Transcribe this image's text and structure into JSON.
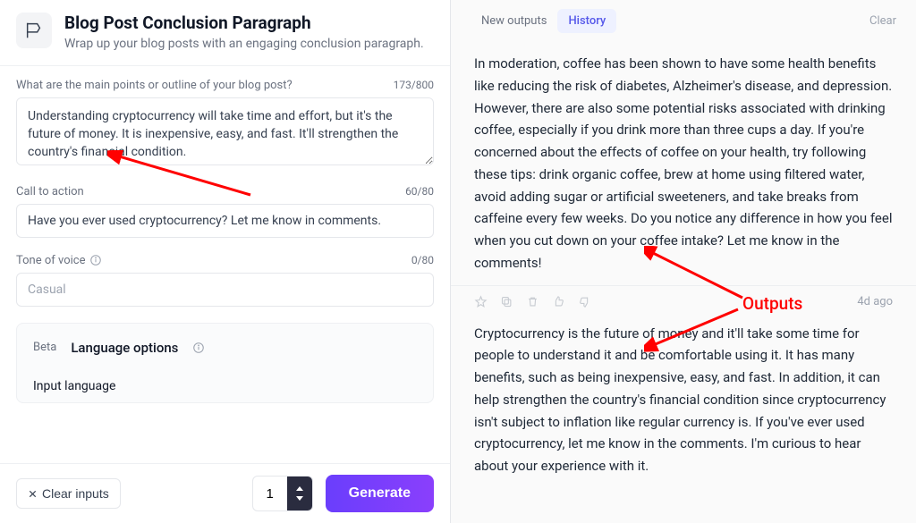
{
  "header": {
    "title": "Blog Post Conclusion Paragraph",
    "subtitle": "Wrap up your blog posts with an engaging conclusion paragraph."
  },
  "fields": {
    "points": {
      "label": "What are the main points or outline of your blog post?",
      "counter": "173/800",
      "value": "Understanding cryptocurrency will take time and effort, but it's the future of money. It is inexpensive, easy, and fast. It'll strengthen the country's financial condition."
    },
    "cta": {
      "label": "Call to action",
      "counter": "60/80",
      "value": "Have you ever used cryptocurrency? Let me know in comments."
    },
    "tone": {
      "label": "Tone of voice",
      "counter": "0/80",
      "placeholder": "Casual"
    }
  },
  "lang": {
    "beta": "Beta",
    "title": "Language options",
    "input_label": "Input language"
  },
  "footer": {
    "clear": "Clear inputs",
    "qty": "1",
    "generate": "Generate"
  },
  "tabs": {
    "new_outputs": "New outputs",
    "history": "History",
    "clear": "Clear"
  },
  "outputs": [
    {
      "text": "In moderation, coffee has been shown to have some health benefits like reducing the risk of diabetes, Alzheimer's disease, and depression. However, there are also some potential risks associated with drinking coffee, especially if you drink more than three cups a day. If you're concerned about the effects of coffee on your health, try following these tips: drink organic coffee, brew at home using filtered water, avoid adding sugar or artificial sweeteners, and take breaks from caffeine every few weeks. Do you notice any difference in how you feel when you cut down on your coffee intake? Let me know in the comments!"
    },
    {
      "ago": "4d ago",
      "text": "Cryptocurrency is the future of money and it'll take some time for people to understand it and be comfortable using it. It has many benefits, such as being inexpensive, easy, and fast. In addition, it can help strengthen the country's financial condition since cryptocurrency isn't subject to inflation like regular currency is. If you've ever used cryptocurrency, let me know in the comments. I'm curious to hear about your experience with it."
    }
  ],
  "annotation": {
    "label": "Outputs"
  }
}
